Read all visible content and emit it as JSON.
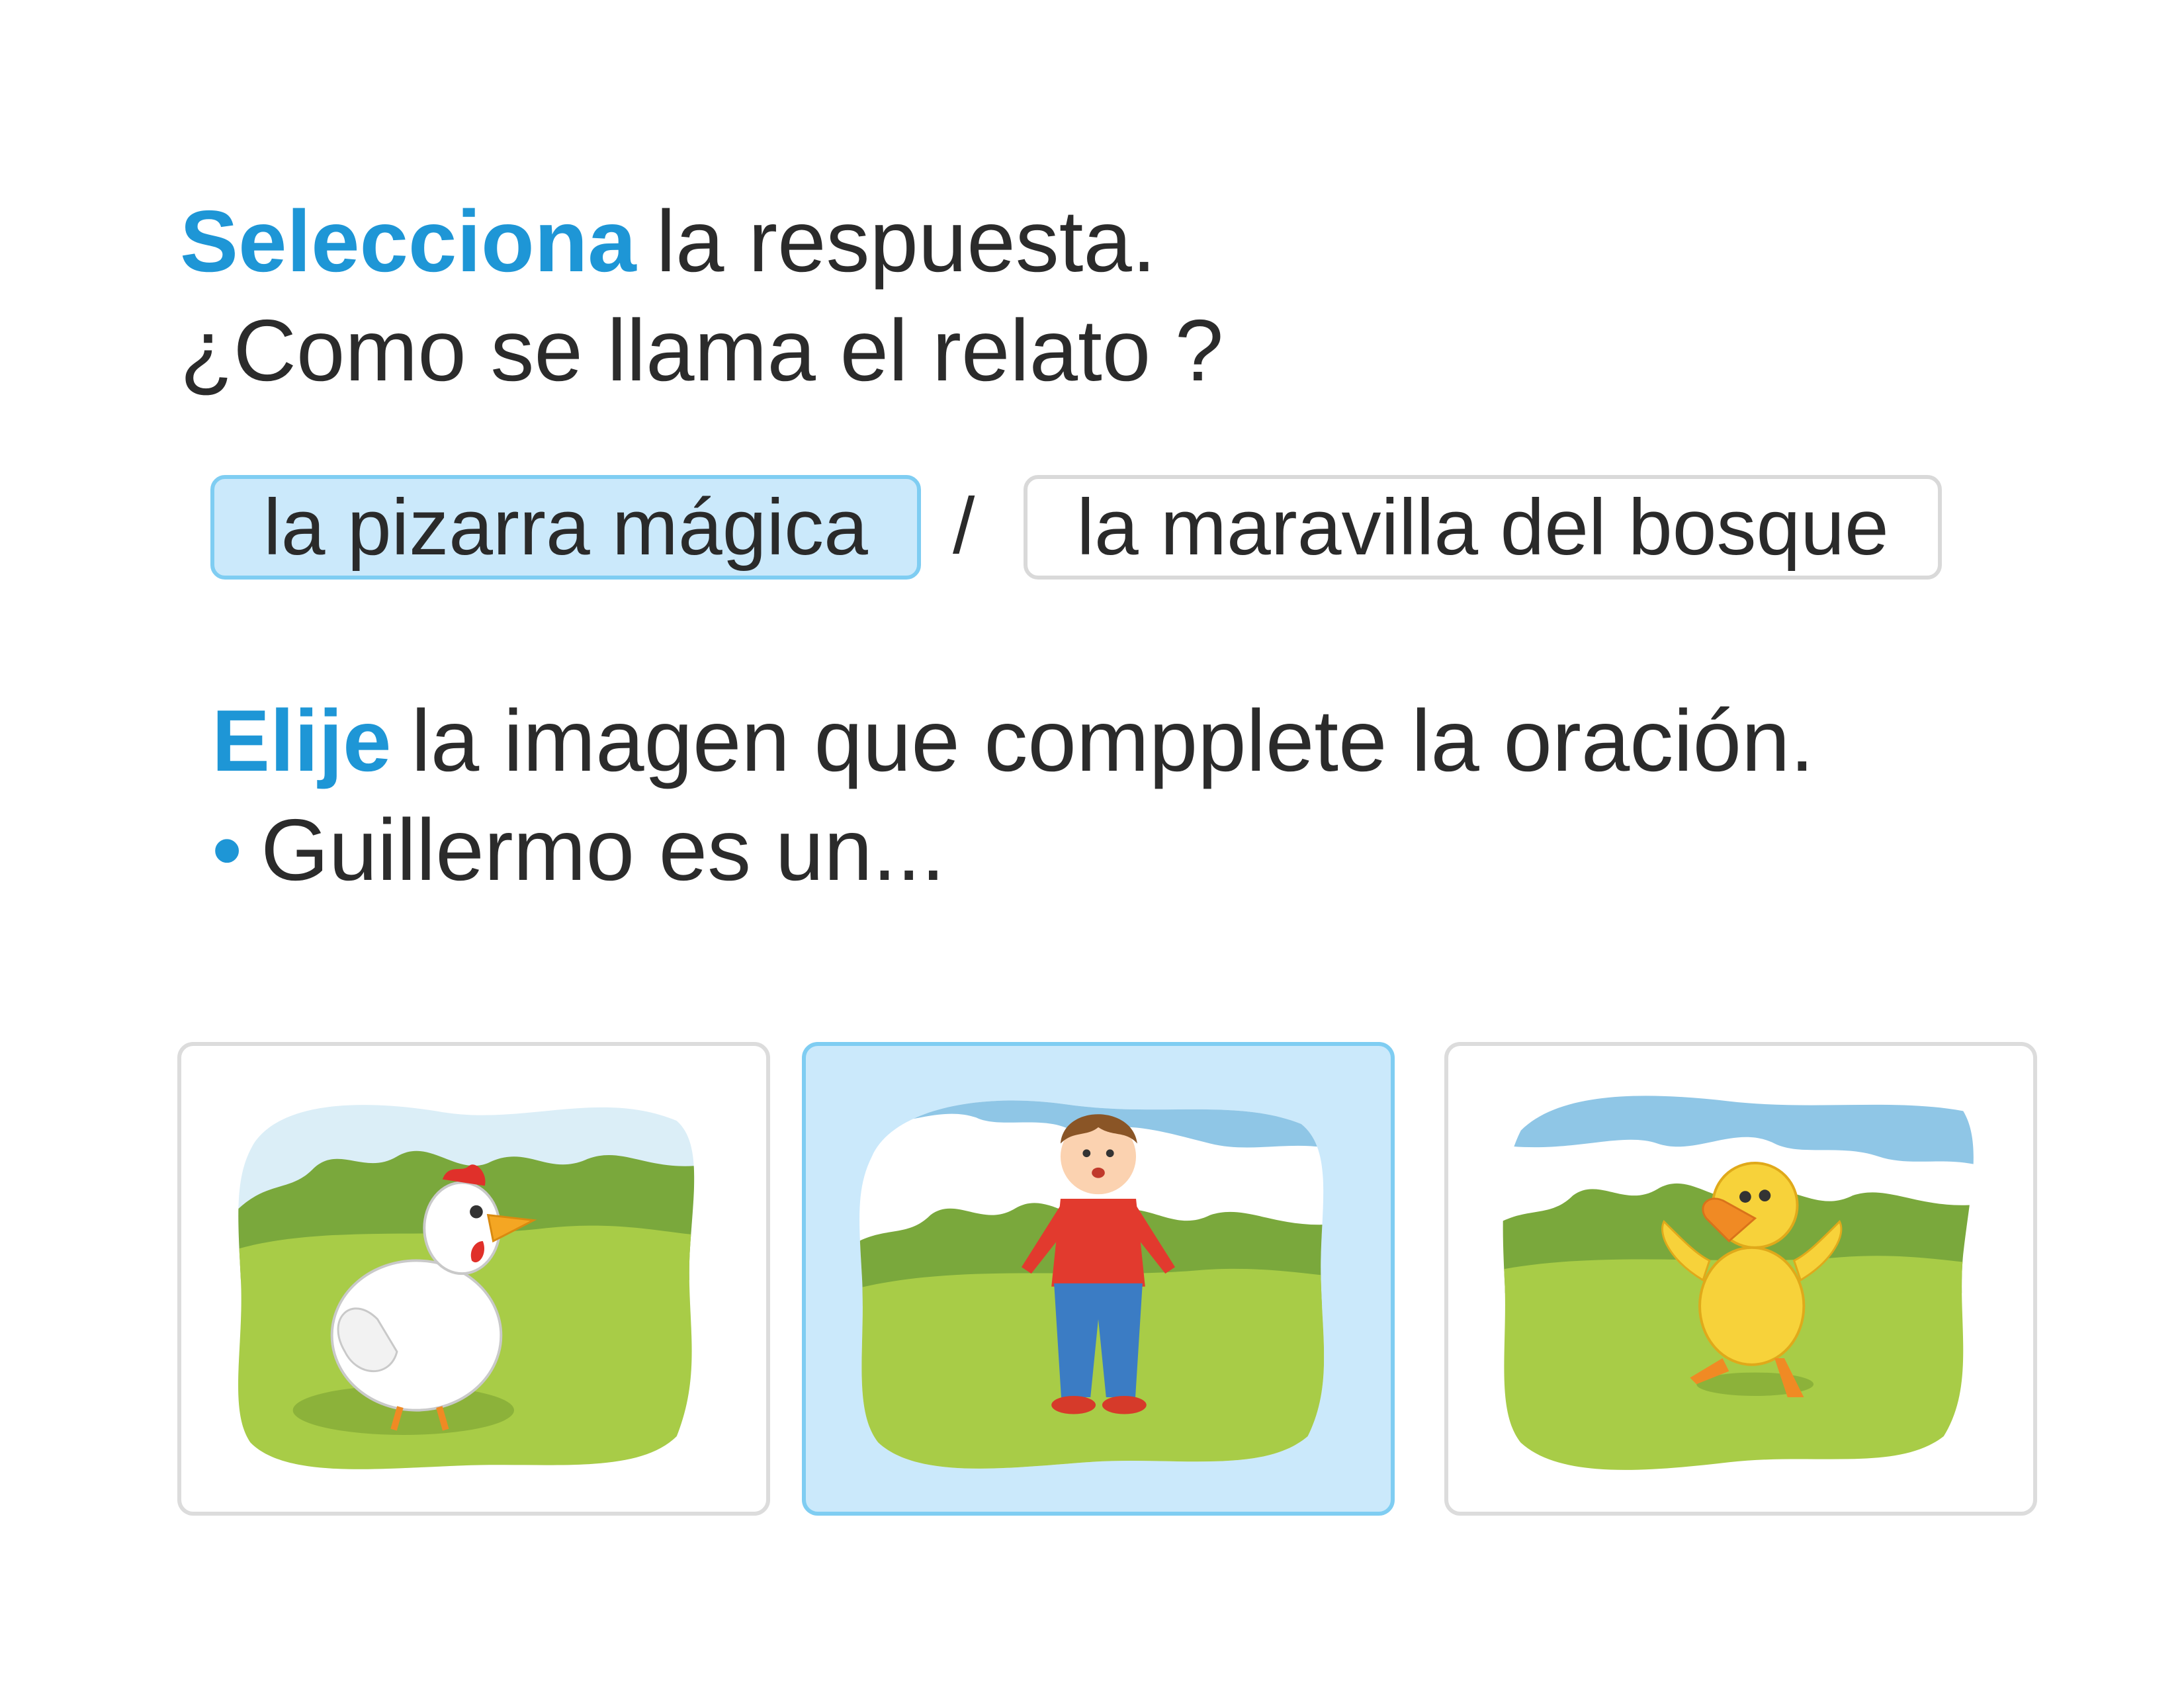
{
  "question1": {
    "verb": "Selecciona",
    "rest": "la respuesta.",
    "prompt": "¿Como se llama el relato ?",
    "options": [
      "la pizarra mágica",
      "la maravilla del bosque"
    ],
    "separator": "/",
    "selected_index": 0
  },
  "question2": {
    "verb": "Elije",
    "rest": "la imagen que compplete la oración.",
    "bullet": "•",
    "sentence": "Guillermo es un...",
    "images": [
      "hen-image",
      "boy-image",
      "duckling-image"
    ],
    "selected_index": 1
  },
  "colors": {
    "accent": "#1e96d6",
    "selected_fill": "#cbe9fb",
    "selected_border": "#7fcdf2",
    "unselected_border": "#d9d9d9"
  }
}
